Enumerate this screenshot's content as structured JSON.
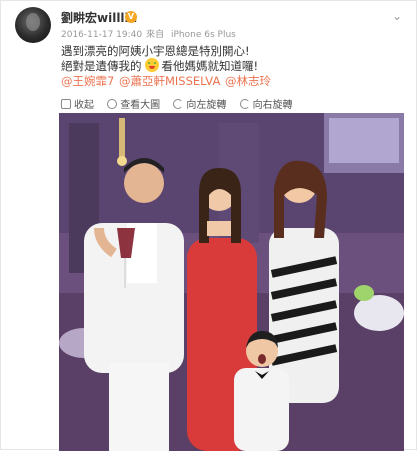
{
  "post": {
    "username": "劉畊宏willliu",
    "vip_badge": "V",
    "timestamp": "2016-11-17 19:40",
    "source_prefix": "來自",
    "source": "iPhone 6s Plus",
    "text_line1": "遇到漂亮的阿姨小宇恩總是特別開心!",
    "text_line2_a": "絕對是遺傳我的",
    "text_line2_b": "看他媽媽就知道囉!",
    "mentions": [
      "@王婉霏7",
      "@蕭亞軒MISSELVA",
      "@林志玲"
    ]
  },
  "actions": {
    "collapse": "收起",
    "zoom": "查看大圖",
    "rotate_left": "向左旋轉",
    "rotate_right": "向右旋轉"
  },
  "colors": {
    "mention": "#eb7350",
    "text": "#333333",
    "meta": "#999999"
  },
  "icons": [
    "user-avatar",
    "vip-badge-icon",
    "dropdown-caret-icon",
    "grin-emoji-icon",
    "collapse-icon",
    "zoom-icon",
    "rotate-left-icon",
    "rotate-right-icon"
  ]
}
